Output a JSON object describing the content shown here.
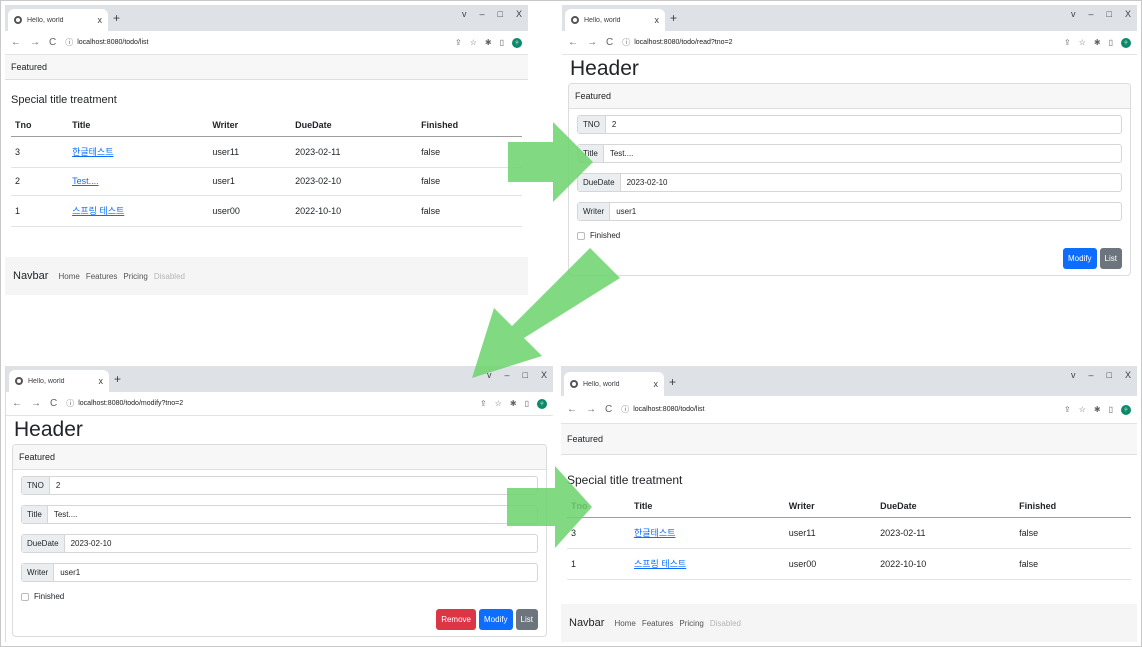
{
  "browser": {
    "tab_title": "Hello, world",
    "tab_close": "x",
    "new_tab": "+",
    "controls": [
      "v",
      "–",
      "□",
      "X"
    ],
    "nav": [
      "←",
      "→",
      "C"
    ],
    "info_icon": "ⓘ",
    "tool_icons": [
      "⇪",
      "☆",
      "✱",
      "▯"
    ],
    "avatar": "우"
  },
  "windows": {
    "list1": {
      "url": "localhost:8080/todo/list",
      "featured": "Featured",
      "card_title": "Special title treatment",
      "headers": [
        "Tno",
        "Title",
        "Writer",
        "DueDate",
        "Finished"
      ],
      "rows": [
        {
          "tno": "3",
          "title": "한글테스트",
          "writer": "user11",
          "due": "2023-02-11",
          "finished": "false"
        },
        {
          "tno": "2",
          "title": "Test....",
          "writer": "user1",
          "due": "2023-02-10",
          "finished": "false"
        },
        {
          "tno": "1",
          "title": "스프링 테스트",
          "writer": "user00",
          "due": "2022-10-10",
          "finished": "false"
        }
      ],
      "navbar": {
        "brand": "Navbar",
        "home": "Home",
        "features": "Features",
        "pricing": "Pricing",
        "disabled": "Disabled"
      }
    },
    "read": {
      "url": "localhost:8080/todo/read?tno=2",
      "header": "Header",
      "featured": "Featured",
      "fields": {
        "tno_label": "TNO",
        "tno": "2",
        "title_label": "Title",
        "title": "Test....",
        "due_label": "DueDate",
        "due": "2023-02-10",
        "writer_label": "Writer",
        "writer": "user1"
      },
      "finished_label": "Finished",
      "modify": "Modify",
      "list": "List"
    },
    "modify": {
      "url": "localhost:8080/todo/modify?tno=2",
      "header": "Header",
      "featured": "Featured",
      "fields": {
        "tno_label": "TNO",
        "tno": "2",
        "title_label": "Title",
        "title": "Test....",
        "due_label": "DueDate",
        "due": "2023-02-10",
        "writer_label": "Writer",
        "writer": "user1"
      },
      "finished_label": "Finished",
      "remove": "Remove",
      "modify": "Modify",
      "list": "List"
    },
    "list2": {
      "url": "localhost:8080/todo/list",
      "featured": "Featured",
      "card_title": "Special title treatment",
      "headers": [
        "Tno",
        "Title",
        "Writer",
        "DueDate",
        "Finished"
      ],
      "rows": [
        {
          "tno": "3",
          "title": "한글테스트",
          "writer": "user11",
          "due": "2023-02-11",
          "finished": "false"
        },
        {
          "tno": "1",
          "title": "스프링 테스트",
          "writer": "user00",
          "due": "2022-10-10",
          "finished": "false"
        }
      ],
      "navbar": {
        "brand": "Navbar",
        "home": "Home",
        "features": "Features",
        "pricing": "Pricing",
        "disabled": "Disabled"
      }
    }
  },
  "colors": {
    "arrow": "#5fd35f",
    "primary": "#0d6efd",
    "danger": "#dc3545",
    "secondary": "#6c757d",
    "tabstrip": "#dee1e6"
  }
}
